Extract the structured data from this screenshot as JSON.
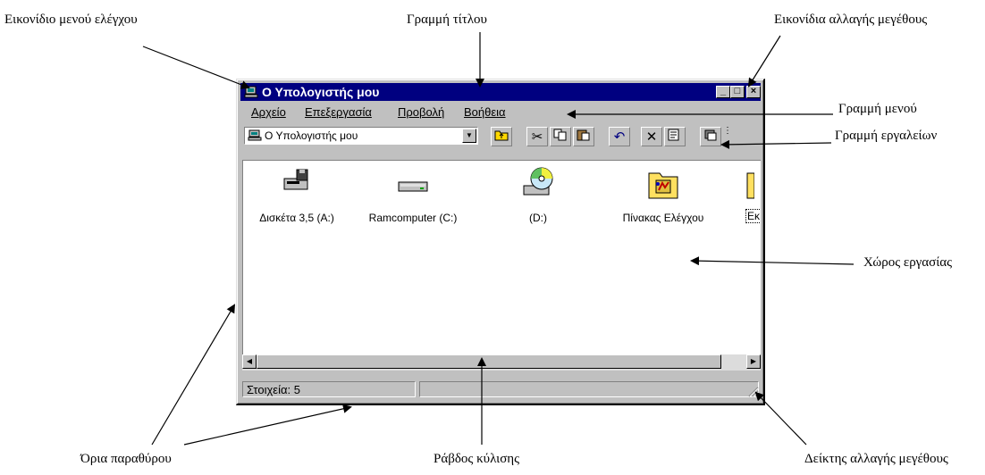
{
  "annotations": {
    "control_menu_icon": "Εικονίδιο μενού ελέγχου",
    "title_bar": "Γραμμή τίτλου",
    "resize_icons": "Εικονίδια αλλαγής μεγέθους",
    "menu_bar": "Γραμμή μενού",
    "toolbar": "Γραμμή εργαλείων",
    "workspace": "Χώρος εργασίας",
    "window_borders": "Όρια παραθύρου",
    "scroll_bar": "Ράβδος κύλισης",
    "resize_indicator": "Δείκτης αλλαγής μεγέθους"
  },
  "window": {
    "title": "Ο Υπολογιστής μου",
    "minimize": "_",
    "maximize": "□",
    "close": "×",
    "menu": [
      "Αρχείο",
      "Επεξεργασία",
      "Προβολή",
      "Βοήθεια"
    ],
    "address": "Ο Υπολογιστής μου",
    "toolbar_icons": [
      "up-folder-icon",
      "cut-icon",
      "copy-icon",
      "paste-icon",
      "undo-icon",
      "delete-icon",
      "properties-icon",
      "large-icons-icon"
    ],
    "items": [
      {
        "label": "Δισκέτα 3,5 (A:)",
        "icon": "floppy-drive-icon"
      },
      {
        "label": "Ramcomputer (C:)",
        "icon": "hard-drive-icon"
      },
      {
        "label": "(D:)",
        "icon": "cd-drive-icon"
      },
      {
        "label": "Πίνακας Ελέγχου",
        "icon": "control-panel-icon"
      },
      {
        "label": "Εκ",
        "icon": "printers-folder-icon"
      }
    ],
    "status": "Στοιχεία: 5"
  },
  "colors": {
    "title_bar": "#000080",
    "window_face": "#c0c0c0"
  }
}
